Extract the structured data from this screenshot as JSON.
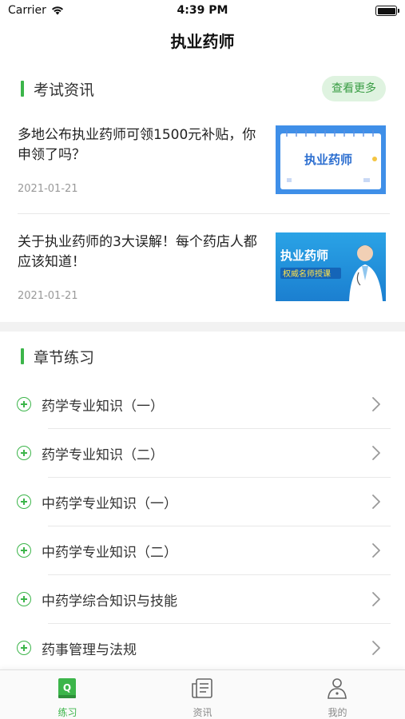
{
  "status_bar": {
    "carrier": "Carrier",
    "time": "4:39 PM"
  },
  "nav": {
    "title": "执业药师"
  },
  "news_section": {
    "title": "考试资讯",
    "more_label": "查看更多",
    "items": [
      {
        "title": "多地公布执业药师可领1500元补贴，你申领了吗？",
        "date": "2021-01-21",
        "thumb_text": "执业药师"
      },
      {
        "title": "关于执业药师的3大误解！每个药店人都应该知道！",
        "date": "2021-01-21",
        "thumb_text": "执业药师",
        "thumb_subtext": "权威名师授课"
      }
    ]
  },
  "chapter_section": {
    "title": "章节练习",
    "items": [
      {
        "label": "药学专业知识（一）"
      },
      {
        "label": "药学专业知识（二）"
      },
      {
        "label": "中药学专业知识（一）"
      },
      {
        "label": "中药学专业知识（二）"
      },
      {
        "label": "中药学综合知识与技能"
      },
      {
        "label": "药事管理与法规"
      }
    ]
  },
  "tabs": [
    {
      "label": "练习",
      "icon": "practice-book-icon",
      "active": true
    },
    {
      "label": "资讯",
      "icon": "news-icon",
      "active": false
    },
    {
      "label": "我的",
      "icon": "profile-icon",
      "active": false
    }
  ],
  "colors": {
    "accent": "#3cb54a",
    "more_bg": "#dff3e0",
    "divider": "#e8e8e8",
    "thumb_blue": "#3f8fe8"
  }
}
